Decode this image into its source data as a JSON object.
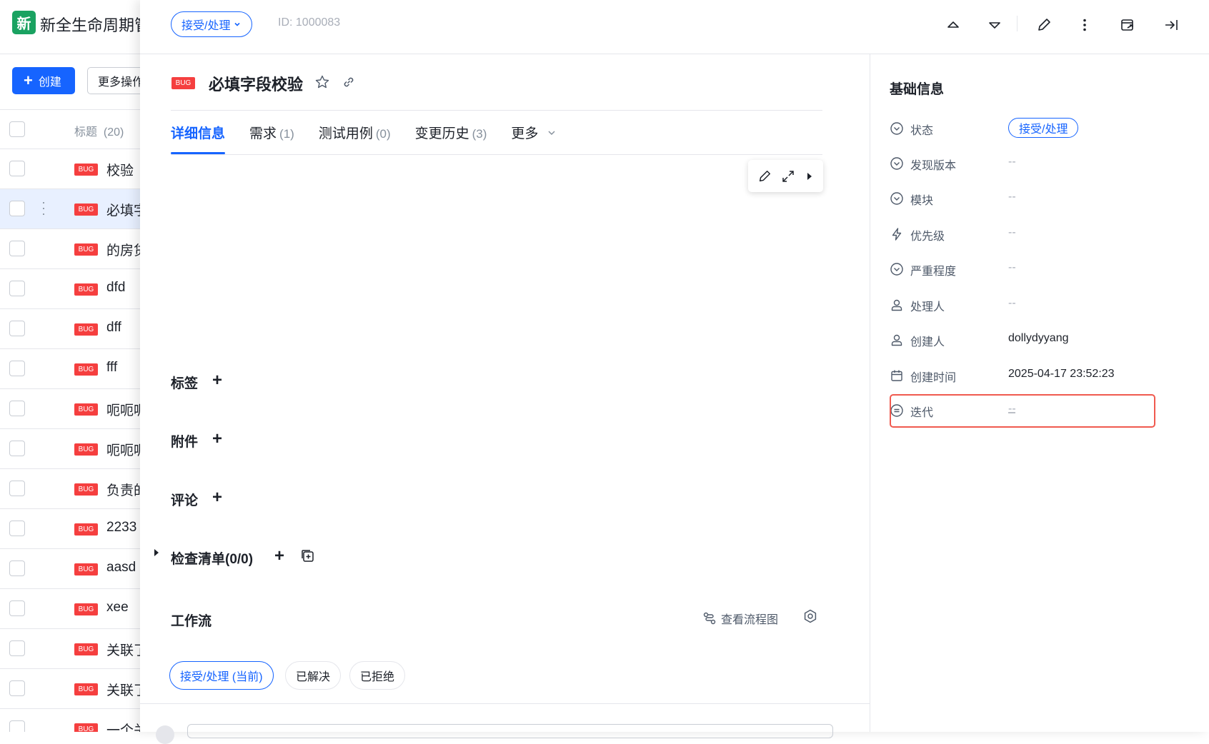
{
  "app": {
    "logo_char": "新",
    "title": "新全生命周期管理"
  },
  "left": {
    "create_label": "创建",
    "more_label": "更多操作",
    "header_label": "标题",
    "header_count": "(20)",
    "rows": [
      {
        "tag": "BUG",
        "title": "校验"
      },
      {
        "tag": "BUG",
        "title": "必填字段校验"
      },
      {
        "tag": "BUG",
        "title": "的房贷"
      },
      {
        "tag": "BUG",
        "title": "dfd"
      },
      {
        "tag": "BUG",
        "title": "dff"
      },
      {
        "tag": "BUG",
        "title": "fff"
      },
      {
        "tag": "BUG",
        "title": "呃呃呃"
      },
      {
        "tag": "BUG",
        "title": "呃呃呃"
      },
      {
        "tag": "BUG",
        "title": "负责的"
      },
      {
        "tag": "BUG",
        "title": "2233"
      },
      {
        "tag": "BUG",
        "title": "aasd"
      },
      {
        "tag": "BUG",
        "title": "xee"
      },
      {
        "tag": "BUG",
        "title": "关联了"
      },
      {
        "tag": "BUG",
        "title": "关联了"
      },
      {
        "tag": "BUG",
        "title": "一个关"
      }
    ]
  },
  "topbar": {
    "status": "接受/处理",
    "id_text": "ID: 1000083"
  },
  "detail": {
    "tag": "BUG",
    "title": "必填字段校验",
    "tabs": [
      {
        "label": "详细信息",
        "count": ""
      },
      {
        "label": "需求",
        "count": "(1)"
      },
      {
        "label": "测试用例",
        "count": "(0)"
      },
      {
        "label": "变更历史",
        "count": "(3)"
      },
      {
        "label": "更多",
        "count": ""
      }
    ],
    "sections": {
      "tags": "标签",
      "attachments": "附件",
      "comments": "评论",
      "checklist": "检查清单(0/0)"
    },
    "workflow": {
      "title": "工作流",
      "view_flow": "查看流程图",
      "states": [
        "接受/处理 (当前)",
        "已解决",
        "已拒绝"
      ]
    }
  },
  "info": {
    "title": "基础信息",
    "fields": [
      {
        "icon": "dropdown-circle-icon",
        "label": "状态",
        "value": "接受/处理"
      },
      {
        "icon": "dropdown-circle-icon",
        "label": "发现版本",
        "value": "--"
      },
      {
        "icon": "dropdown-circle-icon",
        "label": "模块",
        "value": "--"
      },
      {
        "icon": "lightning-icon",
        "label": "优先级",
        "value": "--"
      },
      {
        "icon": "dropdown-circle-icon",
        "label": "严重程度",
        "value": "--"
      },
      {
        "icon": "user-icon",
        "label": "处理人",
        "value": "--"
      },
      {
        "icon": "user-icon",
        "label": "创建人",
        "value": "dollydyyang"
      },
      {
        "icon": "calendar-icon",
        "label": "创建时间",
        "value": "2025-04-17 23:52:23"
      },
      {
        "icon": "iteration-icon",
        "label": "迭代",
        "value": "--"
      }
    ]
  },
  "colors": {
    "primary": "#1664ff",
    "bug_red": "#f53f3f",
    "highlight": "#f05a4f",
    "logo_green": "#1aa261"
  }
}
